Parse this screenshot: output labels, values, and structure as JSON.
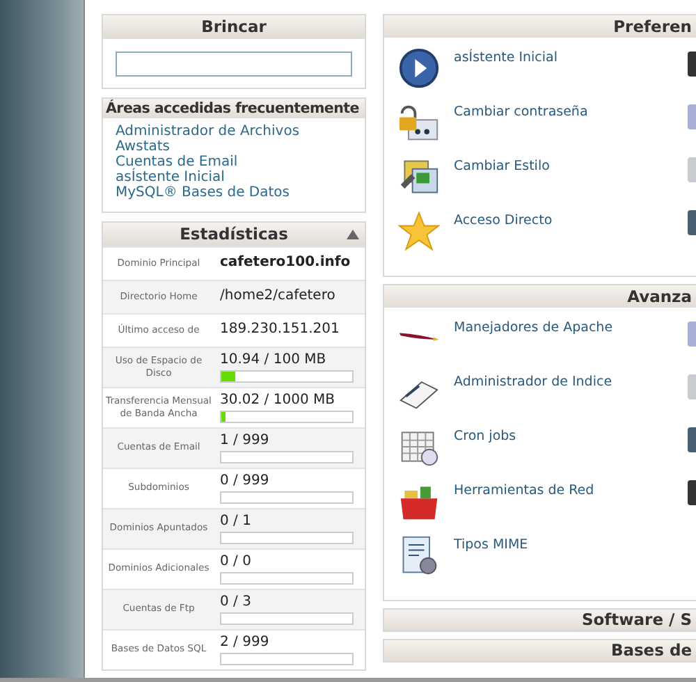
{
  "jump": {
    "title": "Brincar"
  },
  "frequent": {
    "title": "Áreas accedidas frecuentemente",
    "links": [
      "Administrador de Archivos",
      "Awstats",
      "Cuentas de Email",
      "asÍstente Inicial",
      "MySQL® Bases de Datos"
    ]
  },
  "stats": {
    "title": "Estadísticas",
    "expanded": true,
    "rows": [
      {
        "label": "Dominio Principal",
        "value": "cafetero100.info",
        "bold": true
      },
      {
        "label": "Directorio Home",
        "value": "/home2/cafetero",
        "bold": false
      },
      {
        "label": "Último acceso de",
        "value": "189.230.151.201",
        "bold": false
      },
      {
        "label": "Uso de Espacio de Disco",
        "value": "10.94 / 100 MB",
        "bold": false,
        "level": 0.11
      },
      {
        "label": "Transferencia Mensual de Banda Ancha",
        "value": "30.02 / 1000 MB",
        "bold": false,
        "level": 0.03
      },
      {
        "label": "Cuentas de Email",
        "value": "1 / 999",
        "bold": false,
        "kind": "bar"
      },
      {
        "label": "Subdominios",
        "value": "0 / 999",
        "bold": false,
        "kind": "bar"
      },
      {
        "label": "Dominios Apuntados",
        "value": "0 / 1",
        "bold": false,
        "kind": "bar"
      },
      {
        "label": "Dominios Adicionales",
        "value": "0 / 0",
        "bold": false,
        "kind": "bar"
      },
      {
        "label": "Cuentas de Ftp",
        "value": "0 / 3",
        "bold": false,
        "kind": "bar"
      },
      {
        "label": "Bases de Datos SQL",
        "value": "2 / 999",
        "bold": false,
        "kind": "bar"
      }
    ]
  },
  "preferences": {
    "title": "Preferen",
    "items": [
      "asÍstente Inicial",
      "Cambiar contraseña",
      "Cambiar Estilo",
      "Acceso Directo"
    ]
  },
  "advanced": {
    "title": "Avanza",
    "items": [
      "Manejadores de Apache",
      "Administrador de Indice",
      "Cron jobs",
      "Herramientas de Red",
      "Tipos MIME"
    ]
  },
  "collapsed_panels": [
    "Software / S",
    "Bases de"
  ]
}
